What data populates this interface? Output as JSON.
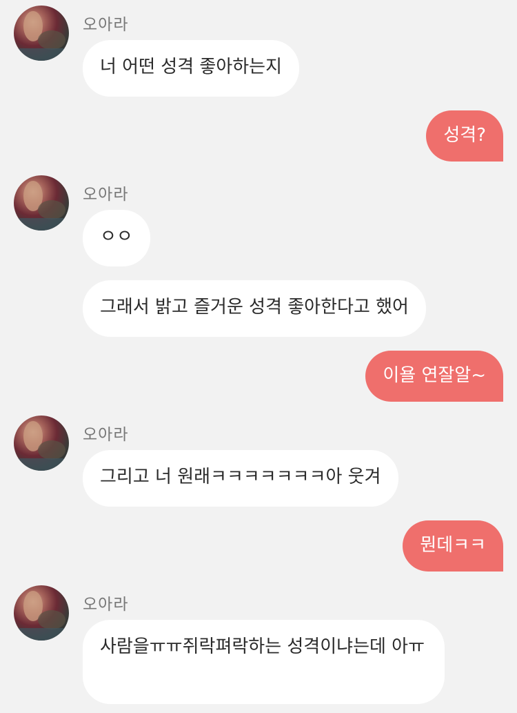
{
  "conversation": {
    "sender_name": "오아라",
    "messages": [
      {
        "text": "너 어떤 성격 좋아하는지"
      },
      {
        "text": "성격?"
      },
      {
        "text": "ㅇㅇ"
      },
      {
        "text": "그래서 밝고 즐거운 성격 좋아한다고 했어"
      },
      {
        "text": "이욜 연잘알~"
      },
      {
        "text": "그리고 너 원래ㅋㅋㅋㅋㅋㅋㅋ아 웃겨"
      },
      {
        "text": "뭔데ㅋㅋ"
      },
      {
        "text": "사람을ㅠㅠ쥐락펴락하는 성격이냐는데 아ㅠ"
      }
    ]
  },
  "colors": {
    "background": "#f2f2f2",
    "incoming_bubble": "#ffffff",
    "outgoing_bubble": "#ef6f6c"
  }
}
